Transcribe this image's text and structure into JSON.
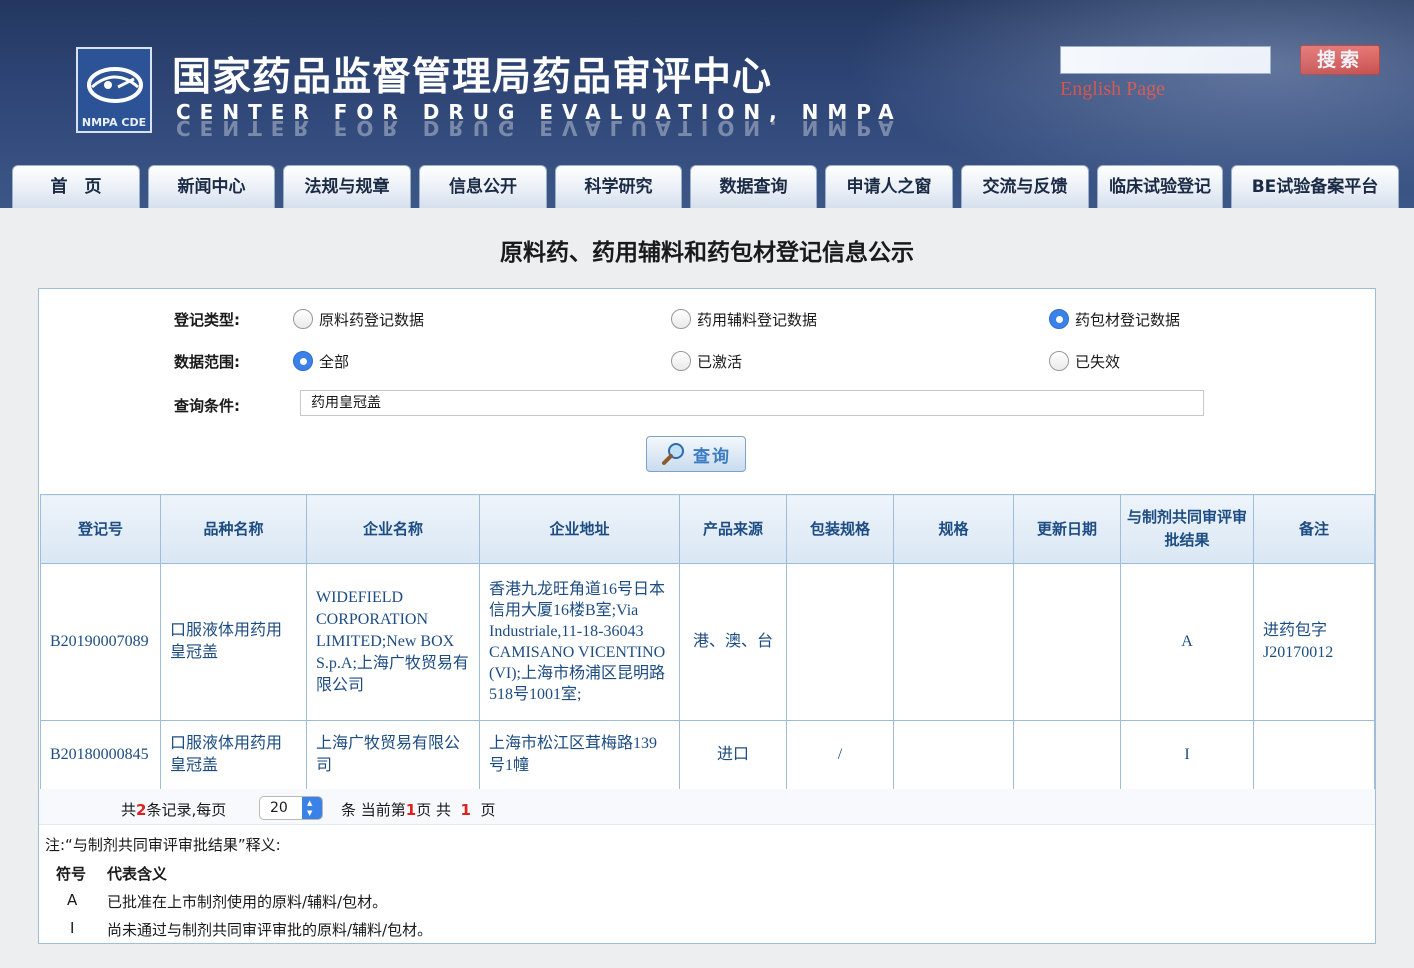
{
  "header": {
    "logo_text": "NMPA CDE",
    "title_cn": "国家药品监督管理局药品审评中心",
    "title_en": "CENTER FOR DRUG EVALUATION, NMPA",
    "search_placeholder": "",
    "search_button": "搜索",
    "english_link": "English Page"
  },
  "nav": {
    "tabs": [
      "首　页",
      "新闻中心",
      "法规与规章",
      "信息公开",
      "科学研究",
      "数据查询",
      "申请人之窗",
      "交流与反馈",
      "临床试验登记",
      "BE试验备案平台"
    ]
  },
  "page_title": "原料药、药用辅料和药包材登记信息公示",
  "form": {
    "type_label": "登记类型:",
    "type_options": [
      "原料药登记数据",
      "药用辅料登记数据",
      "药包材登记数据"
    ],
    "type_selected": "药包材登记数据",
    "scope_label": "数据范围:",
    "scope_options": [
      "全部",
      "已激活",
      "已失效"
    ],
    "scope_selected": "全部",
    "query_label": "查询条件:",
    "query_value": "药用皇冠盖",
    "query_button": "查询"
  },
  "table": {
    "headers": [
      "登记号",
      "品种名称",
      "企业名称",
      "企业地址",
      "产品来源",
      "包装规格",
      "规格",
      "更新日期",
      "与制剂共同审评审批结果",
      "备注"
    ],
    "rows": [
      [
        "B20190007089",
        "口服液体用药用皇冠盖",
        "WIDEFIELD CORPORATION LIMITED;New BOX S.p.A;上海广牧贸易有限公司",
        "香港九龙旺角道16号日本信用大厦16楼B室;Via Industriale,11-18-36043 CAMISANO VICENTINO (VI);上海市杨浦区昆明路518号1001室;",
        "港、澳、台",
        "",
        "",
        "",
        "A",
        "进药包字J20170012"
      ],
      [
        "B20180000845",
        "口服液体用药用皇冠盖",
        "上海广牧贸易有限公司",
        "上海市松江区茸梅路139号1幢",
        "进口",
        "/",
        "",
        "",
        "I",
        ""
      ]
    ]
  },
  "pager": {
    "total_prefix": "共",
    "total": "2",
    "total_suffix": "条记录,每页",
    "per_page": "20",
    "current_prefix": "条 当前第",
    "current_page": "1",
    "pages_mid": "页 共",
    "total_pages": "1",
    "pages_suffix": "页"
  },
  "note": {
    "title": "注:“与制剂共同审评审批结果”释义:",
    "head_symbol": "符号",
    "head_meaning": "代表含义",
    "items": [
      {
        "symbol": "A",
        "meaning": "已批准在上市制剂使用的原料/辅料/包材。"
      },
      {
        "symbol": "I",
        "meaning": "尚未通过与制剂共同审评审批的原料/辅料/包材。"
      }
    ]
  },
  "colors": {
    "header_bg": "#2f4677",
    "search_button": "#e03a2e",
    "table_text": "#1d4c83",
    "radio_checked": "#3b82e8",
    "pager_highlight": "#e01f1f"
  }
}
